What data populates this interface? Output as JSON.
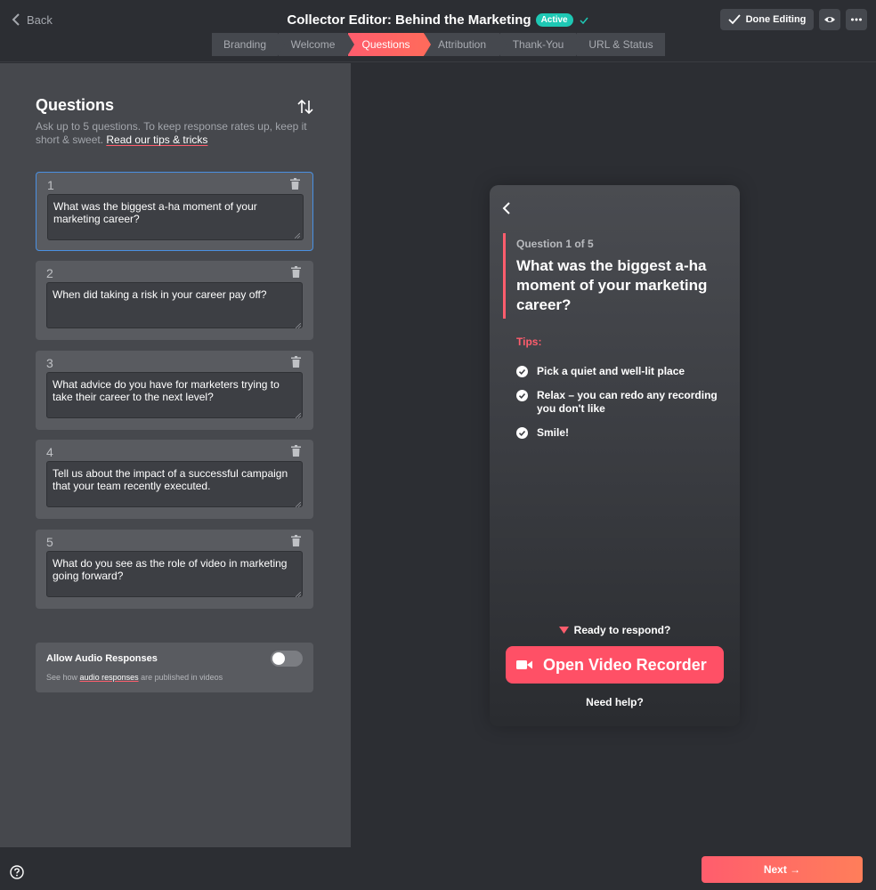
{
  "header": {
    "back_label": "Back",
    "title": "Collector Editor: Behind the Marketing",
    "status_badge": "Active",
    "done_label": "Done Editing",
    "steps": [
      "Branding",
      "Welcome",
      "Questions",
      "Attribution",
      "Thank-You",
      "URL & Status"
    ],
    "active_step": "Questions"
  },
  "questions_panel": {
    "title": "Questions",
    "description": "Ask up to 5 questions. To keep response rates up, keep it short & sweet.",
    "tips_link": "Read our tips & tricks",
    "questions": [
      {
        "number": "1",
        "text": "What was the biggest a-ha moment of your marketing career?"
      },
      {
        "number": "2",
        "text": "When did taking a risk in your career pay off?"
      },
      {
        "number": "3",
        "text": "What advice do you have for marketers trying to take their career to the next level?"
      },
      {
        "number": "4",
        "text": "Tell us about the impact of a successful campaign that your team recently executed."
      },
      {
        "number": "5",
        "text": "What do you see as the role of video in marketing going forward?"
      }
    ],
    "audio": {
      "title": "Allow Audio Responses",
      "sub_prefix": "See how",
      "sub_link": "audio responses",
      "sub_suffix": "are published in videos",
      "enabled": false
    }
  },
  "preview": {
    "question_counter": "Question 1 of 5",
    "question": "What was the biggest a-ha moment of your marketing career?",
    "tips_label": "Tips:",
    "tips": [
      "Pick a quiet and well-lit place",
      "Relax – you can redo any recording you don't like",
      "Smile!"
    ],
    "ready_label": "Ready to respond?",
    "record_button": "Open Video Recorder",
    "help_label": "Need help?"
  },
  "footer": {
    "next_label": "Next →"
  },
  "colors": {
    "accent": "#ff5d6d",
    "badge": "#1ec8b4",
    "panel": "#46484d",
    "background": "#2c2e33"
  }
}
